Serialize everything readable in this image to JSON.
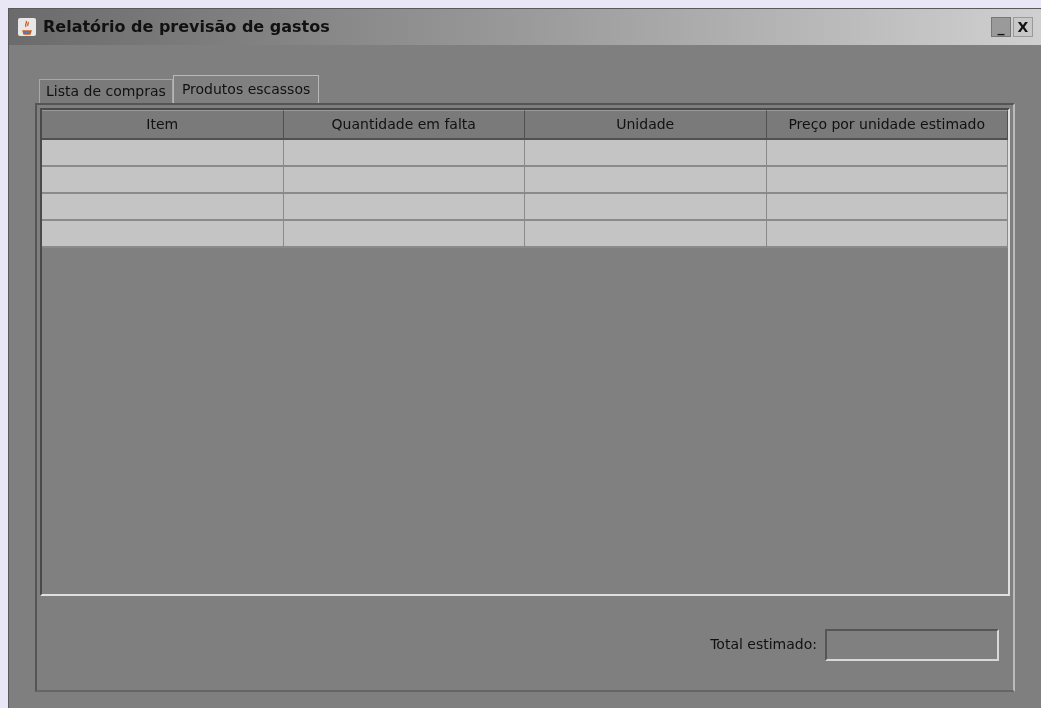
{
  "window": {
    "title": "Relatório de previsão de gastos",
    "controls": [
      {
        "kind": "minimize",
        "label": "_"
      },
      {
        "kind": "close",
        "label": "X"
      }
    ]
  },
  "tabs": [
    {
      "label": "Lista de compras",
      "selected": false
    },
    {
      "label": "Produtos escassos",
      "selected": true
    }
  ],
  "table": {
    "columns": [
      "Item",
      "Quantidade em falta",
      "Unidade",
      "Preço por unidade estimado"
    ],
    "rows": [
      {
        "kind": "empty"
      },
      {
        "kind": "empty"
      },
      {
        "kind": "empty"
      },
      {
        "kind": "empty"
      }
    ]
  },
  "total": {
    "label": "Total estimado:"
  }
}
